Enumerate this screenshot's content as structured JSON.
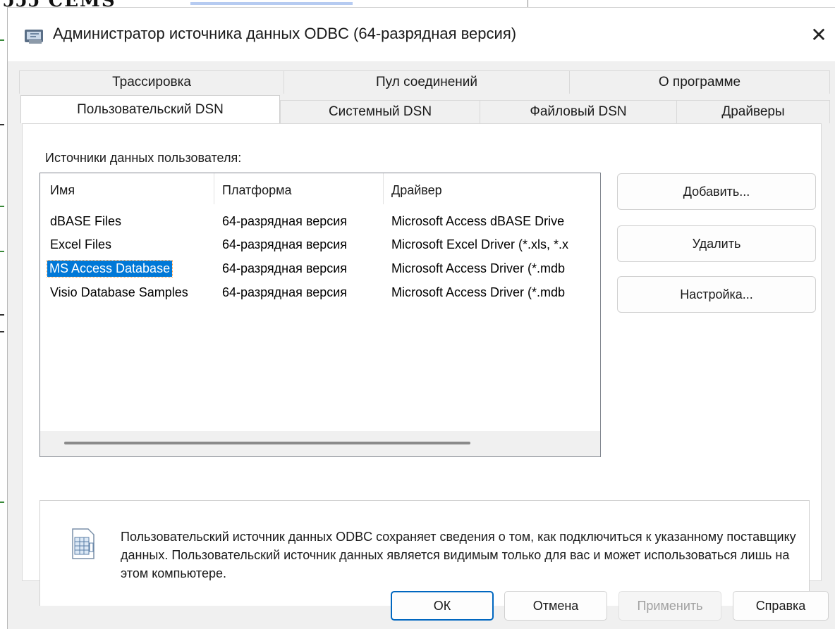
{
  "background": {
    "top_text": "ɔɔɔ CEMS"
  },
  "window": {
    "title": "Администратор источника данных ODBC (64-разрядная версия)",
    "close_label": "✕"
  },
  "tabs": {
    "row1": [
      {
        "label": "Трассировка"
      },
      {
        "label": "Пул соединений"
      },
      {
        "label": "О программе"
      }
    ],
    "row2": [
      {
        "label": "Пользовательский DSN",
        "active": true
      },
      {
        "label": "Системный DSN"
      },
      {
        "label": "Файловый DSN"
      },
      {
        "label": "Драйверы"
      }
    ]
  },
  "user_dsn": {
    "group_label": "Источники данных пользователя:",
    "columns": [
      "Имя",
      "Платформа",
      "Драйвер"
    ],
    "rows": [
      {
        "name": "dBASE Files",
        "platform": "64-разрядная версия",
        "driver": "Microsoft Access dBASE Drive"
      },
      {
        "name": "Excel Files",
        "platform": "64-разрядная версия",
        "driver": "Microsoft Excel Driver (*.xls, *.x"
      },
      {
        "name": "MS Access Database",
        "platform": "64-разрядная версия",
        "driver": "Microsoft Access Driver (*.mdb",
        "selected": true
      },
      {
        "name": "Visio Database Samples",
        "platform": "64-разрядная версия",
        "driver": "Microsoft Access Driver (*.mdb"
      }
    ],
    "buttons": {
      "add": "Добавить...",
      "remove": "Удалить",
      "configure": "Настройка..."
    },
    "info_text": "Пользовательский источник данных ODBC сохраняет сведения о том, как подключиться к указанному поставщику данных.  Пользовательский источник данных является видимым только для вас и может использоваться лишь на этом компьютере."
  },
  "footer": {
    "ok": "ОК",
    "cancel": "Отмена",
    "apply": "Применить",
    "help": "Справка"
  },
  "colors": {
    "selection": "#0078d7",
    "default_button_border": "#0067c0",
    "dialog_bg": "#f0f0f0"
  }
}
